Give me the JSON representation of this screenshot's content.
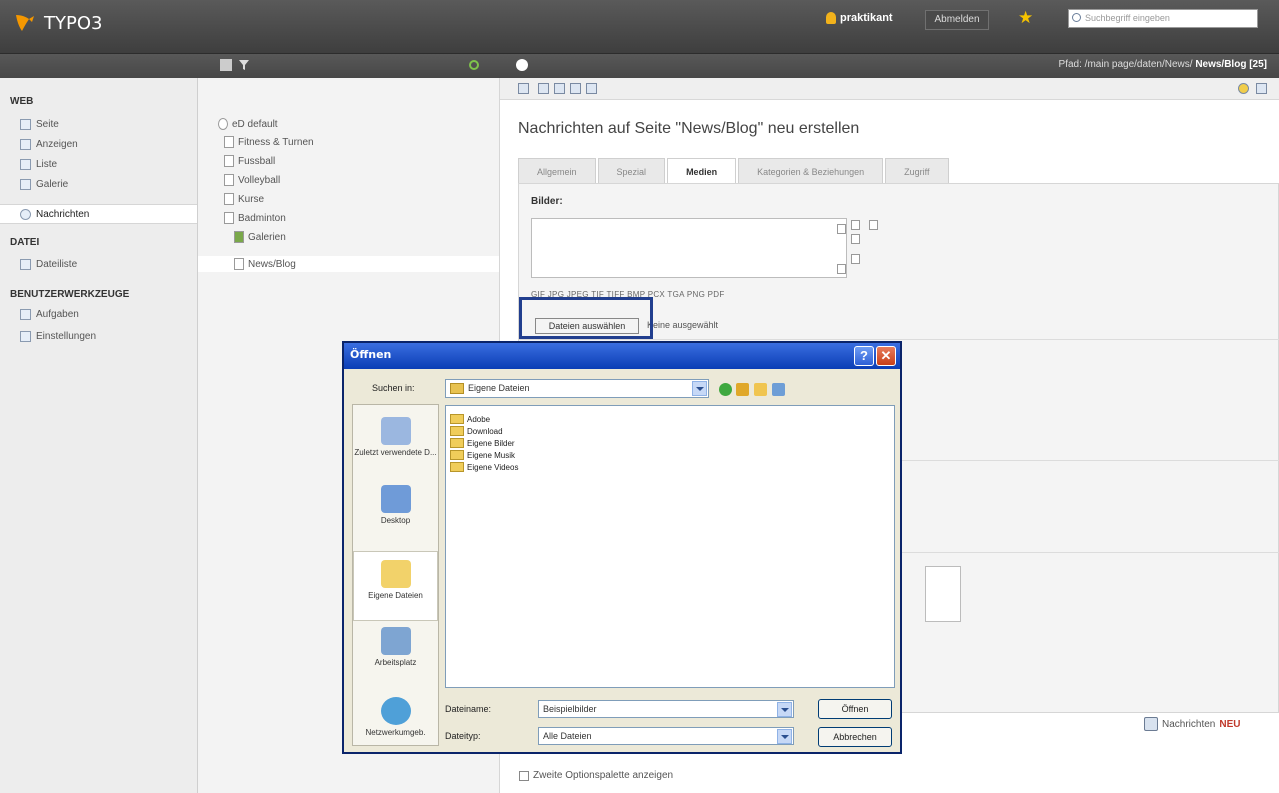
{
  "app": {
    "logo": "TYPO3",
    "user": "praktikant",
    "logout": "Abmelden",
    "search_placeholder": "Suchbegriff eingeben",
    "path_prefix": "Pfad: /main page/daten/News/",
    "path_page": "News/Blog [25]"
  },
  "modules": {
    "web_group": "WEB",
    "web_items": [
      "Seite",
      "Anzeigen",
      "Liste",
      "Galerie",
      "Nachrichten"
    ],
    "dateien_group": "DATEI",
    "dateien_items": [
      "Dateiliste"
    ],
    "tools_group": "BENUTZERWERKZEUGE",
    "tools_items": [
      "Aufgaben",
      "Einstellungen"
    ]
  },
  "tree": {
    "root": "eD default",
    "items": [
      "Fitness & Turnen",
      "Fussball",
      "Volleyball",
      "Kurse",
      "Badminton",
      "Galerien",
      "News/Blog"
    ]
  },
  "content": {
    "heading": "Nachrichten auf Seite \"News/Blog\" neu erstellen",
    "tabs": [
      "Allgemein",
      "Spezial",
      "Medien",
      "Kategorien & Beziehungen",
      "Zugriff"
    ],
    "bilder_label": "Bilder:",
    "extensions": "GIF JPG JPEG TIF TIFF BMP PCX TGA PNG PDF",
    "upload_button": "Dateien auswählen",
    "upload_status": "Keine ausgewählt",
    "add_news_prefix": "Nachrichten",
    "add_news_suffix": "NEU",
    "second_options": "Zweite Optionspalette anzeigen"
  },
  "dialog": {
    "title": "Öffnen",
    "lookin_label": "Suchen in:",
    "lookin_value": "Eigene Dateien",
    "places": [
      "Zuletzt verwendete D...",
      "Desktop",
      "Eigene Dateien",
      "Arbeitsplatz",
      "Netzwerkumgeb."
    ],
    "files": [
      "Adobe",
      "Download",
      "Eigene Bilder",
      "Eigene Musik",
      "Eigene Videos"
    ],
    "filename_label": "Dateiname:",
    "filename_value": "Beispielbilder",
    "filetype_label": "Dateityp:",
    "filetype_value": "Alle Dateien",
    "open_button": "Öffnen",
    "cancel_button": "Abbrechen"
  },
  "colors": {
    "topbar": "#4a4a4a",
    "dialog_title": "#0a3db5",
    "highlight_box": "#213e8e"
  }
}
